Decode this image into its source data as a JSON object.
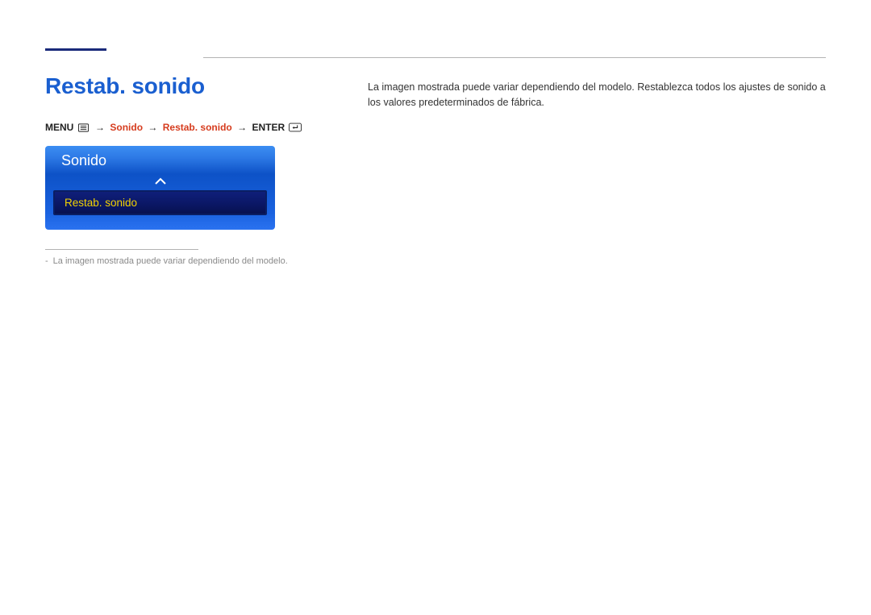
{
  "header": {
    "title": "Restab. sonido"
  },
  "breadcrumb": {
    "menu_label": "MENU",
    "arrow": "→",
    "path_part1": "Sonido",
    "path_part2": "Restab. sonido",
    "enter_label": "ENTER"
  },
  "description": {
    "text": "La imagen mostrada puede variar dependiendo del modelo. Restablezca todos los ajustes de sonido a los valores predeterminados de fábrica."
  },
  "osd": {
    "header": "Sonido",
    "selected_item": "Restab. sonido"
  },
  "footnote": {
    "dash": "-",
    "text": "La imagen mostrada puede variar dependiendo del modelo."
  }
}
